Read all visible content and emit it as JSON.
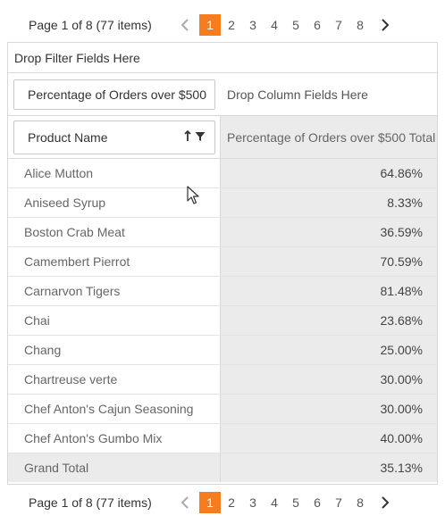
{
  "pager_top": {
    "info": "Page 1 of 8 (77 items)",
    "pages": [
      "1",
      "2",
      "3",
      "4",
      "5",
      "6",
      "7",
      "8"
    ],
    "active_page": "1"
  },
  "filter_area": {
    "label": "Drop Filter Fields Here"
  },
  "column_area": {
    "data_field": "Percentage of Orders over $500",
    "drop_label": "Drop Column Fields Here"
  },
  "row_header": {
    "field": "Product Name",
    "sort_icon": "sort-ascending-icon",
    "filter_icon": "filter-icon"
  },
  "value_header": {
    "label": "Percentage of Orders over $500 Total"
  },
  "rows": [
    {
      "name": "Alice Mutton",
      "value": "64.86%"
    },
    {
      "name": "Aniseed Syrup",
      "value": "8.33%"
    },
    {
      "name": "Boston Crab Meat",
      "value": "36.59%"
    },
    {
      "name": "Camembert Pierrot",
      "value": "70.59%"
    },
    {
      "name": "Carnarvon Tigers",
      "value": "81.48%"
    },
    {
      "name": "Chai",
      "value": "23.68%"
    },
    {
      "name": "Chang",
      "value": "25.00%"
    },
    {
      "name": "Chartreuse verte",
      "value": "30.00%"
    },
    {
      "name": "Chef Anton's Cajun Seasoning",
      "value": "30.00%"
    },
    {
      "name": "Chef Anton's Gumbo Mix",
      "value": "40.00%"
    }
  ],
  "grand_total": {
    "label": "Grand Total",
    "value": "35.13%"
  },
  "pager_bottom": {
    "info": "Page 1 of 8 (77 items)",
    "pages": [
      "1",
      "2",
      "3",
      "4",
      "5",
      "6",
      "7",
      "8"
    ],
    "active_page": "1"
  },
  "colors": {
    "accent": "#f57c1f",
    "value_bg": "#ebebeb",
    "border": "#d9d9d9"
  }
}
